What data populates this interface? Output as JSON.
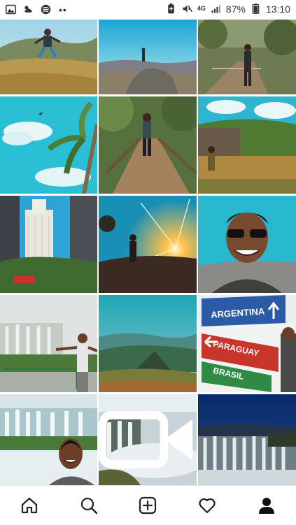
{
  "status_bar": {
    "left_icons": [
      "gallery-icon",
      "weather-icon",
      "spotify-icon",
      "more-dots-icon"
    ],
    "dots": "••",
    "network": "4G",
    "battery_percent": "87%",
    "time": "13:10",
    "right_icons": [
      "battery-saver-icon",
      "mute-icon",
      "signal-icon",
      "battery-icon"
    ]
  },
  "grid": {
    "posts": [
      {
        "name": "post-hiker-jumping-hill"
      },
      {
        "name": "post-person-on-rock-mountains"
      },
      {
        "name": "post-man-on-boardwalk-forest"
      },
      {
        "name": "post-palm-tree-sky"
      },
      {
        "name": "post-man-on-wooden-bridge"
      },
      {
        "name": "post-man-by-river-forest"
      },
      {
        "name": "post-city-skyscraper"
      },
      {
        "name": "post-sunset-silhouette"
      },
      {
        "name": "post-selfie-sunglasses"
      },
      {
        "name": "post-waterfalls-man-arms-open"
      },
      {
        "name": "post-mountain-valley"
      },
      {
        "name": "post-border-signs"
      },
      {
        "name": "post-waterfall-selfie"
      },
      {
        "name": "post-waterfall-mist-video",
        "video": true
      },
      {
        "name": "post-waterfall-night"
      }
    ]
  },
  "nav": {
    "items": [
      "home",
      "search",
      "new-post",
      "activity",
      "profile"
    ]
  },
  "colors": {
    "sky": "#29b6c8",
    "accent_text": "#222222",
    "nav_border": "#e6e6e6"
  }
}
